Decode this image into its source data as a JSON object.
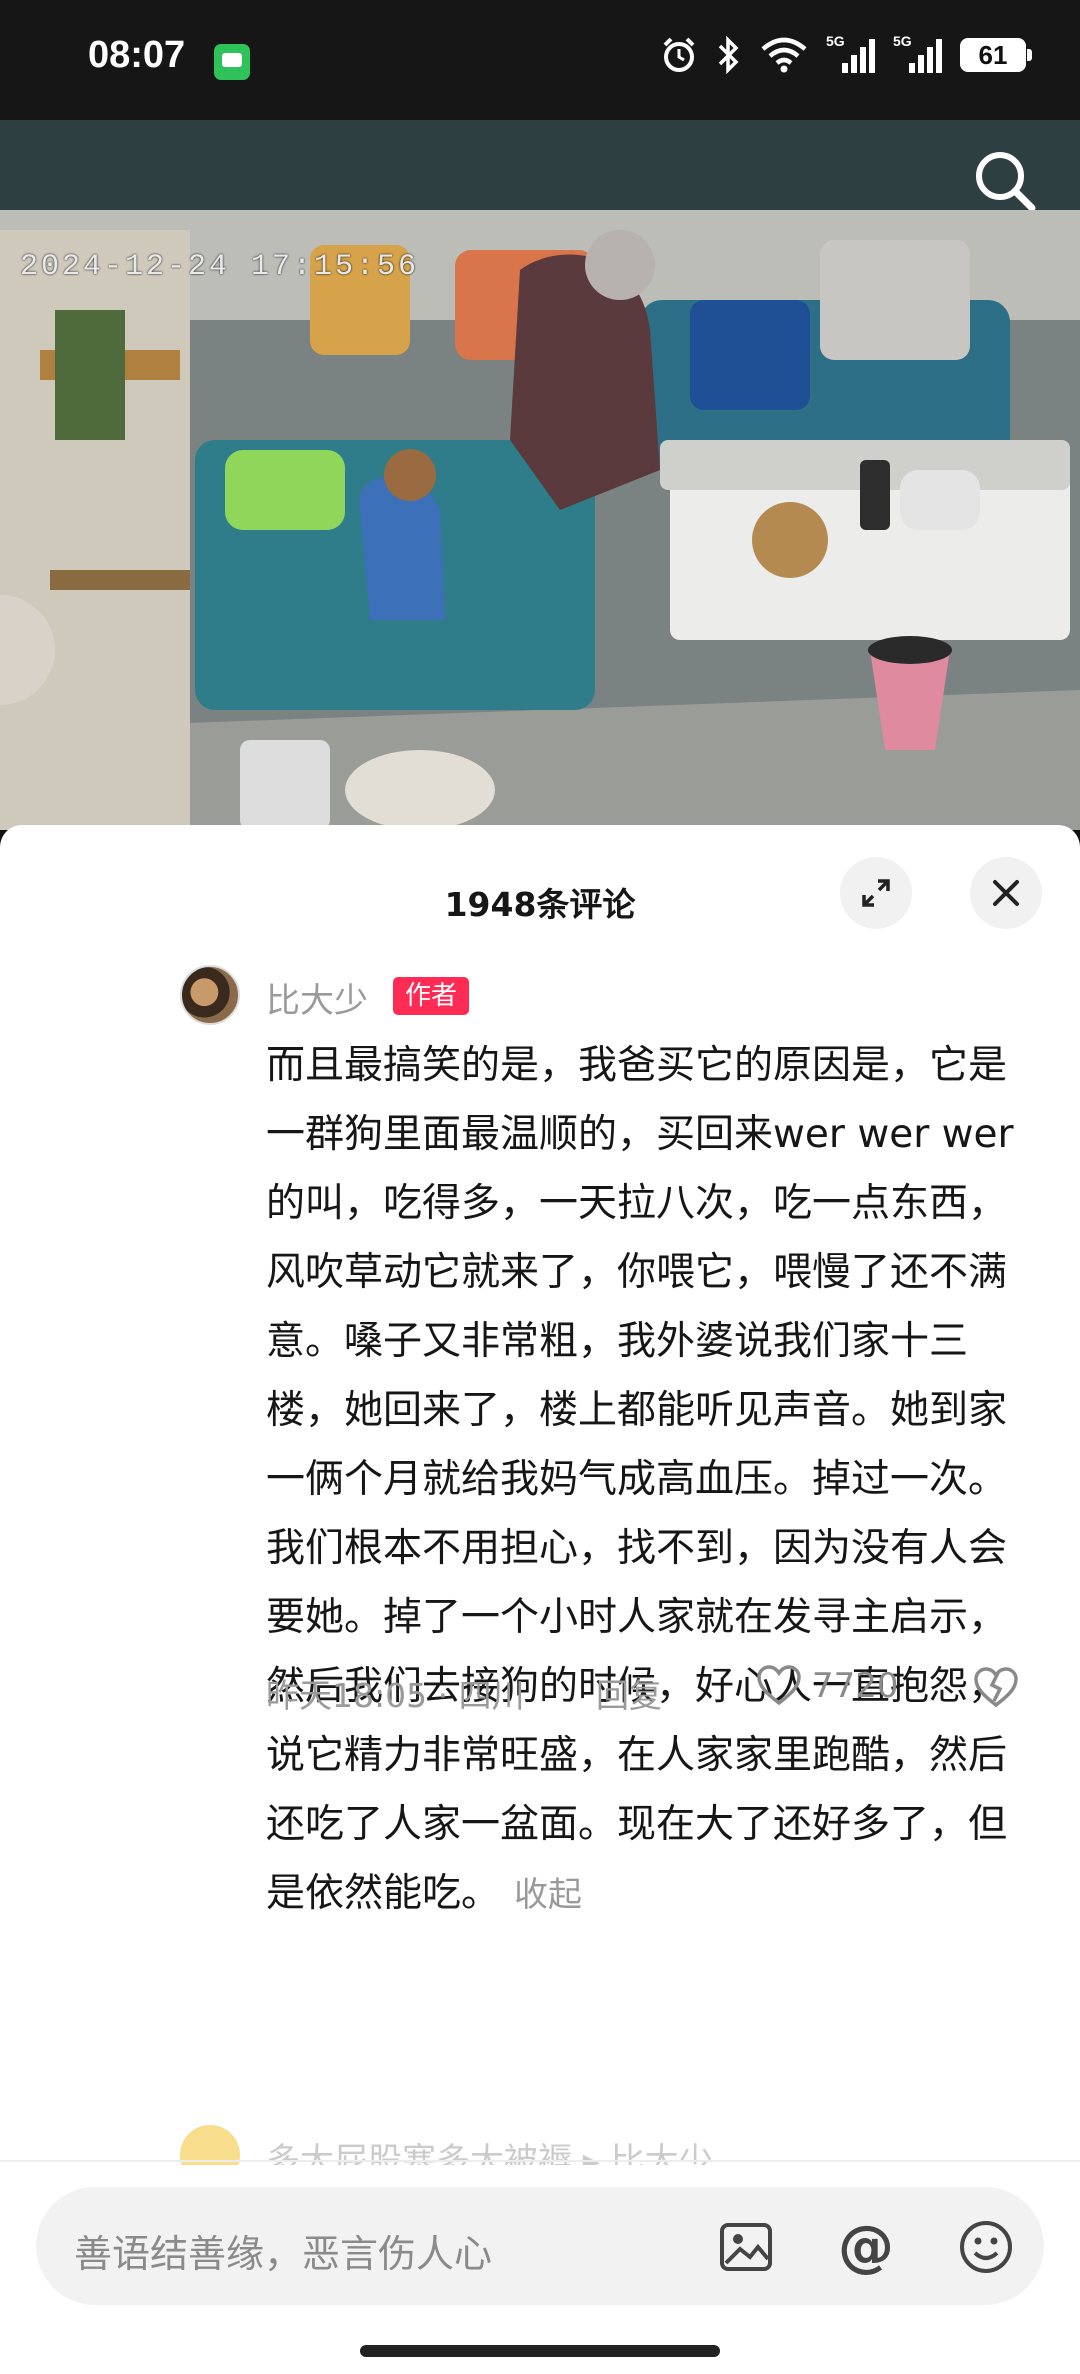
{
  "status_bar": {
    "time": "08:07",
    "battery": "61",
    "network_1": "5G",
    "network_2": "5G",
    "icons": [
      "message-app-icon",
      "alarm-icon",
      "bluetooth-icon",
      "wifi-icon",
      "signal-icon",
      "battery-icon"
    ]
  },
  "top_bar": {
    "search_icon": "search-icon"
  },
  "video": {
    "timestamp": "2024-12-24  17:15:56"
  },
  "comments_panel": {
    "title": "1948条评论",
    "expand_icon": "expand-icon",
    "close_icon": "close-icon"
  },
  "comment": {
    "author": "比大少",
    "badge": "作者",
    "text": "而且最搞笑的是，我爸买它的原因是，它是一群狗里面最温顺的，买回来wer wer wer的叫，吃得多，一天拉八次，吃一点东西，风吹草动它就来了，你喂它，喂慢了还不满意。嗓子又非常粗，我外婆说我们家十三楼，她回来了，楼上都能听见声音。她到家一俩个月就给我妈气成高血压。掉过一次。我们根本不用担心，找不到，因为没有人会要她。掉了一个小时人家就在发寻主启示，然后我们去接狗的时候，好心人一直抱怨，说它精力非常旺盛，在人家家里跑酷，然后还吃了人家一盆面。现在大了还好多了，但是依然能吃。",
    "collapse": "收起",
    "time_location": "昨天18:05 · 四川",
    "reply": "回复",
    "likes": "7720"
  },
  "next_comment": {
    "preview": "多大屁股塞多大被褥 ▸ 比大少"
  },
  "input_bar": {
    "placeholder": "善语结善缘，恶言伤人心",
    "at_symbol": "@"
  },
  "colors": {
    "top_bar": "#2e3f42",
    "badge": "#fe2c55",
    "text": "#161616",
    "muted": "#9a9a9a"
  }
}
